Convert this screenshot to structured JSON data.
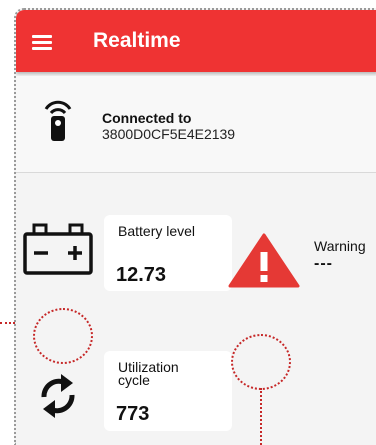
{
  "appbar": {
    "title": "Realtime",
    "menu_icon": "menu-icon",
    "color": "#ef3333"
  },
  "device": {
    "connected_label": "Connected to",
    "device_id": "3800D0CF5E4E2139",
    "icon": "remote-control-icon"
  },
  "battery": {
    "label": "Battery level",
    "value": "12.73",
    "icon": "car-battery-icon"
  },
  "warning": {
    "label": "Warning",
    "value": "---",
    "icon": "warning-triangle-icon",
    "color": "#e53935"
  },
  "cycle": {
    "label": "Utilization cycle",
    "value": "773",
    "icon": "sync-icon"
  }
}
